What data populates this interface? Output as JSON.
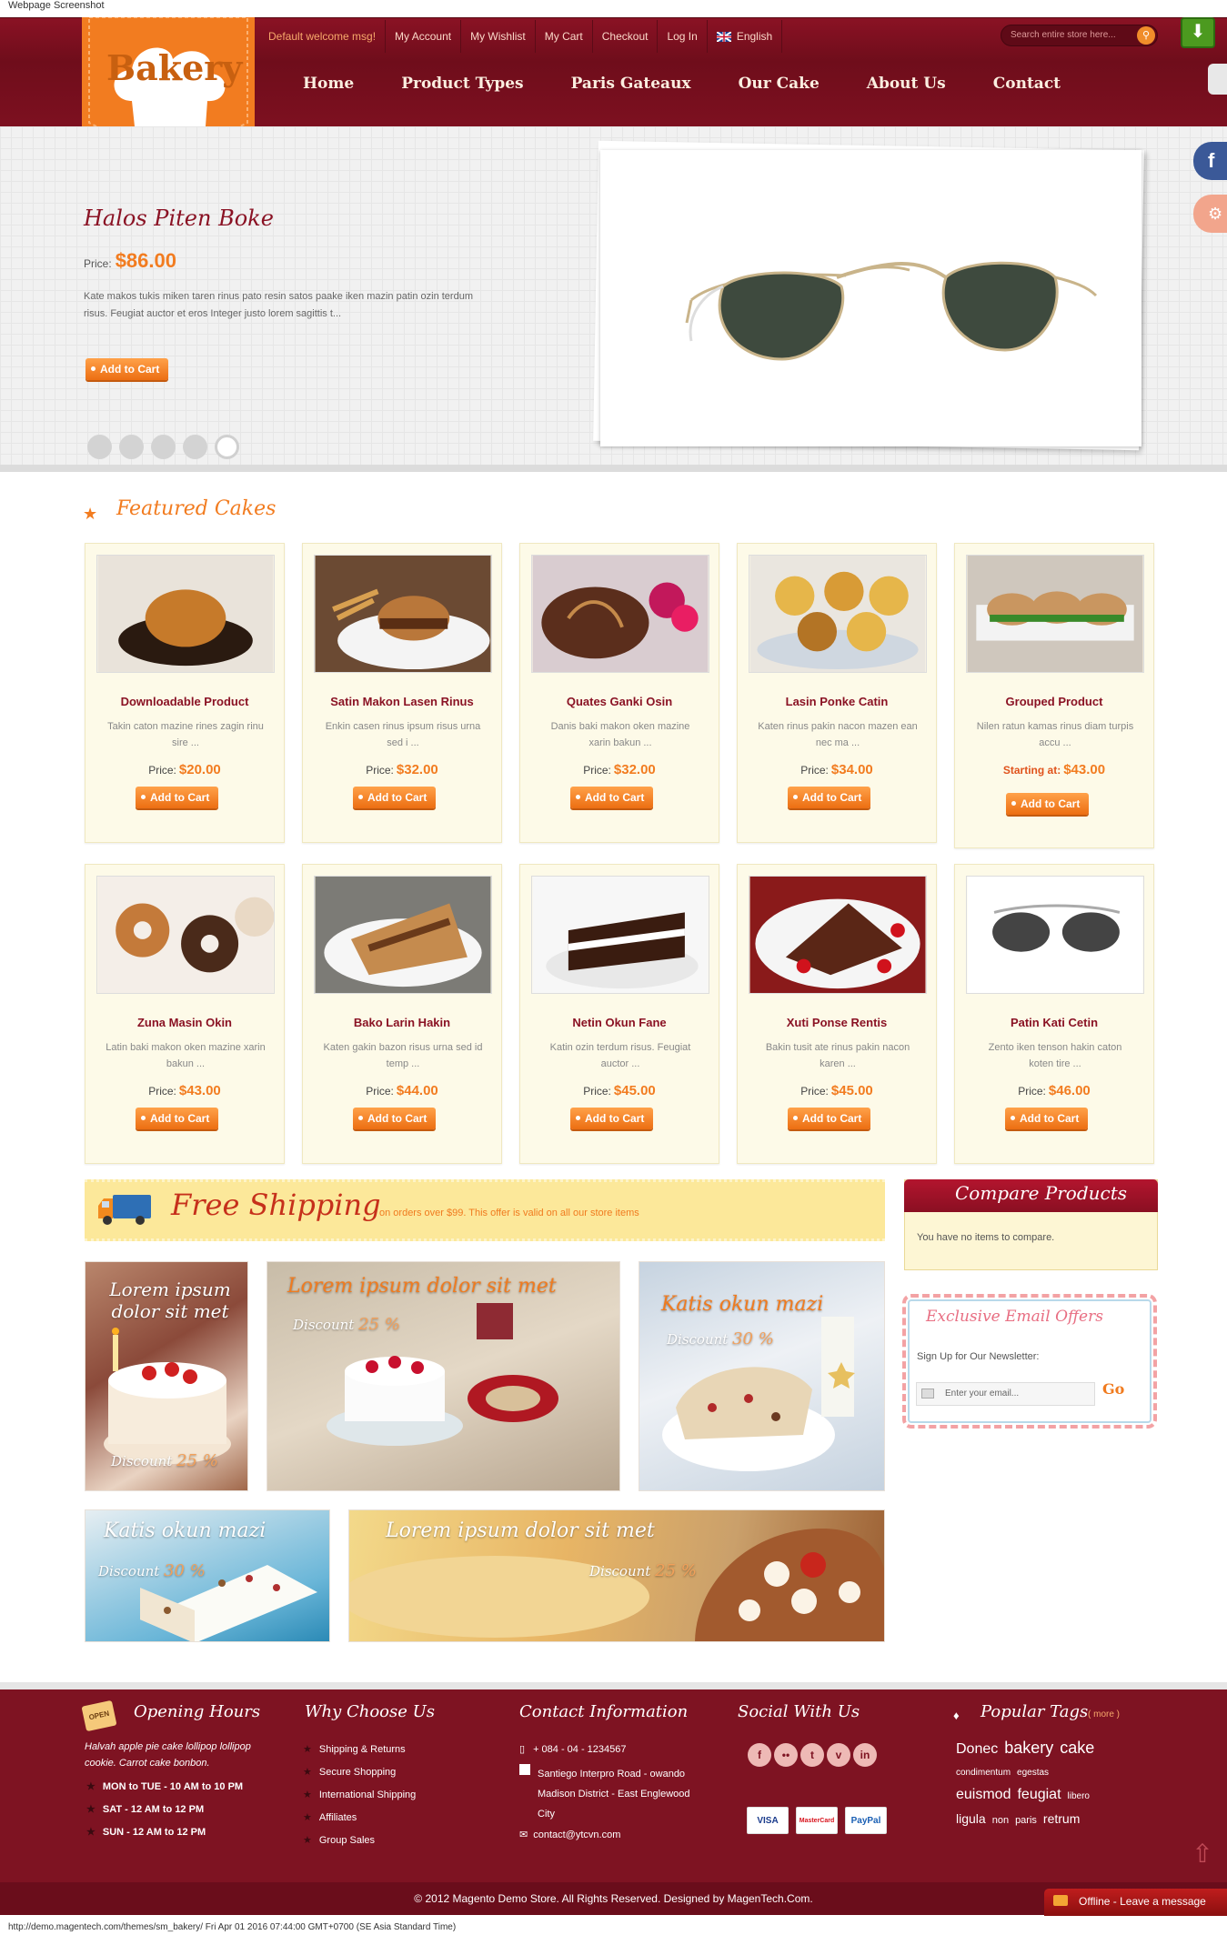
{
  "shot_label": "Webpage Screenshot",
  "util": {
    "welcome": "Default welcome msg!",
    "links": [
      "My Account",
      "My Wishlist",
      "My Cart",
      "Checkout",
      "Log In"
    ],
    "language": "English",
    "search_placeholder": "Search entire store here..."
  },
  "logo_text": "Bakery",
  "nav": [
    "Home",
    "Product Types",
    "Paris Gateaux",
    "Our Cake",
    "About Us",
    "Contact"
  ],
  "slide": {
    "title": "Halos Piten Boke",
    "price_label": "Price:",
    "price": "$86.00",
    "description": "Kate makos tukis miken taren rinus pato resin satos paake iken mazin patin ozin terdum risus. Feugiat auctor et eros Integer justo lorem sagittis t...",
    "cart": "Add to Cart",
    "dots_total": 5,
    "dots_active": 5
  },
  "featured_title": "Featured Cakes",
  "products": [
    {
      "name": "Downloadable Product",
      "desc": "Takin caton mazine rines zagin rinu sire ...",
      "label": "Price:",
      "price": "$20.00",
      "img": "bun"
    },
    {
      "name": "Satin Makon Lasen Rinus",
      "desc": "Enkin casen rinus ipsum risus urna sed i ...",
      "label": "Price:",
      "price": "$32.00",
      "img": "burger"
    },
    {
      "name": "Quates Ganki Osin",
      "desc": "Danis baki makon oken mazine xarin bakun ...",
      "label": "Price:",
      "price": "$32.00",
      "img": "cake"
    },
    {
      "name": "Lasin Ponke Catin",
      "desc": "Katen rinus pakin nacon mazen ean nec ma ...",
      "label": "Price:",
      "price": "$34.00",
      "img": "muffins"
    },
    {
      "name": "Grouped Product",
      "desc": "Nilen ratun kamas rinus diam turpis accu ...",
      "label": "Starting at:",
      "price": "$43.00",
      "img": "sliders"
    },
    {
      "name": "Zuna Masin Okin",
      "desc": "Latin baki makon oken mazine xarin bakun ...",
      "label": "Price:",
      "price": "$43.00",
      "img": "donuts"
    },
    {
      "name": "Bako Larin Hakin",
      "desc": "Katen gakin bazon risus urna sed id temp ...",
      "label": "Price:",
      "price": "$44.00",
      "img": "sandwich"
    },
    {
      "name": "Netin Okun Fane",
      "desc": "Katin ozin terdum risus. Feugiat auctor ...",
      "label": "Price:",
      "price": "$45.00",
      "img": "slice"
    },
    {
      "name": "Xuti Ponse Rentis",
      "desc": "Bakin tusit ate rinus pakin nacon karen ...",
      "label": "Price:",
      "price": "$45.00",
      "img": "brownie"
    },
    {
      "name": "Patin Kati Cetin",
      "desc": "Zento iken tenson hakin caton koten tire ...",
      "label": "Price:",
      "price": "$46.00",
      "img": "glasses"
    }
  ],
  "cart_label": "Add to Cart",
  "shipping": {
    "title": "Free Shipping",
    "text": "on orders over $99. This offer is valid on all our store items"
  },
  "compare": {
    "title": "Compare Products",
    "text": "You have no items to compare."
  },
  "newsletter": {
    "title": "Exclusive Email Offers",
    "label": "Sign Up for Our Newsletter:",
    "placeholder": "Enter your email...",
    "go": "Go"
  },
  "banners": [
    {
      "title": "Lorem ipsum dolor sit met",
      "discount_label": "Discount",
      "discount": "25 %"
    },
    {
      "title": "Lorem ipsum dolor sit met",
      "discount_label": "Discount",
      "discount": "25 %"
    },
    {
      "title": "Katis okun mazi",
      "discount_label": "Discount",
      "discount": "30 %"
    },
    {
      "title": "Katis okun mazi",
      "discount_label": "Discount",
      "discount": "30 %"
    },
    {
      "title": "Lorem ipsum dolor sit met",
      "discount_label": "Discount",
      "discount": "25 %"
    }
  ],
  "footer": {
    "open_sign": "OPEN",
    "hours_title": "Opening Hours",
    "hours_text": "Halvah apple pie cake lollipop lollipop cookie. Carrot cake bonbon.",
    "hours": [
      "MON to TUE - 10 AM to 10 PM",
      "SAT - 12 AM to 12 PM",
      "SUN - 12 AM to 12 PM"
    ],
    "why_title": "Why Choose Us",
    "why": [
      "Shipping & Returns",
      "Secure Shopping",
      "International Shipping",
      "Affiliates",
      "Group Sales"
    ],
    "contact_title": "Contact Information",
    "phone": "+ 084 - 04 - 1234567",
    "address": "Santiego Interpro Road - owando Madison District - East Englewood City",
    "email": "contact@ytcvn.com",
    "social_title": "Social With Us",
    "social": [
      "f",
      "••",
      "t",
      "v",
      "in"
    ],
    "payments": [
      "VISA",
      "MasterCard",
      "PayPal"
    ],
    "tags_title": "Popular Tags",
    "tags_more": "( more )",
    "tags": [
      {
        "t": "Donec",
        "s": 16
      },
      {
        "t": "bakery",
        "s": 18
      },
      {
        "t": "cake",
        "s": 18
      },
      {
        "t": "condimentum",
        "s": 10
      },
      {
        "t": "egestas",
        "s": 10
      },
      {
        "t": "euismod",
        "s": 16
      },
      {
        "t": "feugiat",
        "s": 16
      },
      {
        "t": "libero",
        "s": 10
      },
      {
        "t": "ligula",
        "s": 14
      },
      {
        "t": "non",
        "s": 11
      },
      {
        "t": "paris",
        "s": 11
      },
      {
        "t": "retrum",
        "s": 14
      }
    ],
    "copyright": "© 2012 Magento Demo Store. All Rights Reserved. Designed by MagenTech.Com."
  },
  "chat": "Offline - Leave a message",
  "status_bar": "http://demo.magentech.com/themes/sm_bakery/ Fri Apr 01 2016 07:44:00 GMT+0700 (SE Asia Standard Time)"
}
